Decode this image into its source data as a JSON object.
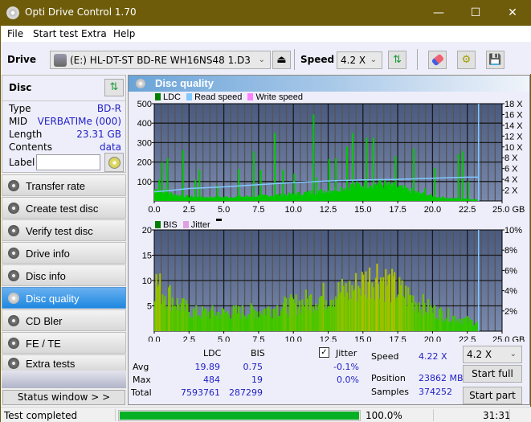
{
  "window": {
    "title": "Opti Drive Control 1.70",
    "controls": {
      "minimize": "—",
      "maximize": "☐",
      "close": "✕"
    }
  },
  "menu": [
    "File",
    "Start test",
    "Extra",
    "Help"
  ],
  "toolbar": {
    "drive_label": "Drive",
    "drive_value": "(E:)  HL-DT-ST BD-RE  WH16NS48 1.D3",
    "speed_label": "Speed",
    "speed_value": "4.2 X",
    "icons": [
      "eject-icon",
      "refresh-icon",
      "eraser-icon",
      "settings-icon",
      "save-icon"
    ]
  },
  "disc": {
    "header": "Disc",
    "rows": [
      {
        "key": "Type",
        "value": "BD-R"
      },
      {
        "key": "MID",
        "value": "VERBATIMe (000)"
      },
      {
        "key": "Length",
        "value": "23.31 GB"
      },
      {
        "key": "Contents",
        "value": "data"
      }
    ],
    "label_key": "Label",
    "label_value": ""
  },
  "nav": [
    {
      "label": "Transfer rate",
      "active": false
    },
    {
      "label": "Create test disc",
      "active": false
    },
    {
      "label": "Verify test disc",
      "active": false
    },
    {
      "label": "Drive info",
      "active": false
    },
    {
      "label": "Disc info",
      "active": false
    },
    {
      "label": "Disc quality",
      "active": true
    },
    {
      "label": "CD Bler",
      "active": false
    },
    {
      "label": "FE / TE",
      "active": false
    },
    {
      "label": "Extra tests",
      "active": false
    }
  ],
  "status_window_button": "Status window > >",
  "panel": {
    "title": "Disc quality"
  },
  "colors": {
    "ldc": "#00c800",
    "read_speed": "#80c8ff",
    "write_speed": "#ff80ff",
    "bis": "#008000",
    "jitter": "#e0a0e0",
    "plot_bg_top": "#4a5a7e",
    "plot_bg_bottom": "#7a8aae",
    "accent": "#1e88e0",
    "progress": "#06b025"
  },
  "chart_data": [
    {
      "type": "bar",
      "title": "LDC / Read speed",
      "legend": [
        "LDC",
        "Read speed",
        "Write speed"
      ],
      "legend_position": "top-left",
      "xlabel": "GB",
      "x_ticks": [
        "0.0",
        "2.5",
        "5.0",
        "7.5",
        "10.0",
        "12.5",
        "15.0",
        "17.5",
        "20.0",
        "22.5",
        "25.0 GB"
      ],
      "xlim": [
        0,
        25
      ],
      "y_left_ticks": [
        "500",
        "400",
        "300",
        "200",
        "100"
      ],
      "ylim_left": [
        0,
        500
      ],
      "y_right_ticks": [
        "18 X",
        "16 X",
        "14 X",
        "12 X",
        "10 X",
        "8 X",
        "6 X",
        "4 X",
        "2 X"
      ],
      "ylim_right": [
        0,
        18
      ],
      "grid": true,
      "end_marker_gb": 23.31,
      "ldc_baseline": [
        [
          0.0,
          60
        ],
        [
          0.5,
          55
        ],
        [
          1.0,
          40
        ],
        [
          2.0,
          25
        ],
        [
          3.0,
          20
        ],
        [
          5.0,
          20
        ],
        [
          7.5,
          25
        ],
        [
          10.0,
          35
        ],
        [
          12.5,
          55
        ],
        [
          14.0,
          75
        ],
        [
          15.5,
          90
        ],
        [
          16.5,
          85
        ],
        [
          17.5,
          70
        ],
        [
          19.0,
          40
        ],
        [
          20.0,
          25
        ],
        [
          21.0,
          15
        ],
        [
          22.5,
          10
        ],
        [
          23.3,
          8
        ]
      ],
      "ldc_spikes": [
        [
          0.3,
          110
        ],
        [
          0.5,
          200
        ],
        [
          0.9,
          220
        ],
        [
          2.0,
          260
        ],
        [
          2.9,
          110
        ],
        [
          3.2,
          160
        ],
        [
          4.5,
          80
        ],
        [
          6.0,
          165
        ],
        [
          7.1,
          255
        ],
        [
          7.6,
          160
        ],
        [
          8.6,
          350
        ],
        [
          9.2,
          160
        ],
        [
          10.0,
          140
        ],
        [
          11.4,
          445
        ],
        [
          11.6,
          120
        ],
        [
          12.5,
          215
        ],
        [
          13.0,
          220
        ],
        [
          13.8,
          280
        ],
        [
          14.2,
          350
        ],
        [
          15.2,
          325
        ],
        [
          15.7,
          325
        ],
        [
          16.2,
          115
        ],
        [
          17.3,
          230
        ],
        [
          18.6,
          270
        ],
        [
          19.4,
          65
        ],
        [
          20.1,
          170
        ],
        [
          21.8,
          240
        ],
        [
          22.1,
          255
        ],
        [
          22.5,
          100
        ]
      ],
      "read_speed": [
        [
          0.0,
          1.7
        ],
        [
          1.0,
          1.9
        ],
        [
          2.5,
          2.3
        ],
        [
          5.0,
          2.6
        ],
        [
          7.5,
          3.0
        ],
        [
          10.0,
          3.4
        ],
        [
          12.5,
          3.7
        ],
        [
          15.0,
          3.9
        ],
        [
          17.5,
          4.0
        ],
        [
          20.0,
          4.2
        ],
        [
          22.5,
          4.4
        ],
        [
          23.3,
          4.4
        ]
      ]
    },
    {
      "type": "bar",
      "title": "BIS / Jitter",
      "legend": [
        "BIS",
        "Jitter"
      ],
      "legend_position": "top-left",
      "xlabel": "GB",
      "x_ticks": [
        "0.0",
        "2.5",
        "5.0",
        "7.5",
        "10.0",
        "12.5",
        "15.0",
        "17.5",
        "20.0",
        "22.5",
        "25.0 GB"
      ],
      "xlim": [
        0,
        25
      ],
      "y_left_ticks": [
        "20",
        "15",
        "10",
        "5"
      ],
      "ylim_left": [
        0,
        20
      ],
      "y_right_ticks": [
        "10%",
        "8%",
        "6%",
        "4%",
        "2%"
      ],
      "ylim_right": [
        0,
        10
      ],
      "grid": true,
      "end_marker_gb": 23.31,
      "bis_envelope": [
        [
          0.0,
          12
        ],
        [
          0.5,
          10
        ],
        [
          1.0,
          9
        ],
        [
          1.5,
          7
        ],
        [
          2.0,
          6
        ],
        [
          2.5,
          5
        ],
        [
          3.0,
          4.5
        ],
        [
          5.0,
          4.5
        ],
        [
          7.5,
          5
        ],
        [
          10.0,
          6.5
        ],
        [
          12.5,
          9
        ],
        [
          14.0,
          10
        ],
        [
          15.0,
          12
        ],
        [
          16.0,
          14
        ],
        [
          17.0,
          11
        ],
        [
          18.0,
          9
        ],
        [
          19.0,
          7
        ],
        [
          20.0,
          5
        ],
        [
          21.0,
          4
        ],
        [
          22.0,
          3
        ],
        [
          23.3,
          2
        ]
      ]
    }
  ],
  "stats": {
    "col_ldc": "LDC",
    "col_bis": "BIS",
    "rows": [
      {
        "label": "Avg",
        "ldc": "19.89",
        "bis": "0.75"
      },
      {
        "label": "Max",
        "ldc": "484",
        "bis": "19"
      },
      {
        "label": "Total",
        "ldc": "7593761",
        "bis": "287299"
      }
    ],
    "jitter_checked": true,
    "jitter_label": "Jitter",
    "jitter_avg": "-0.1%",
    "jitter_max": "0.0%",
    "speed_label": "Speed",
    "speed_value": "4.22 X",
    "position_label": "Position",
    "position_value": "23862 MB",
    "samples_label": "Samples",
    "samples_value": "374252",
    "speed_select": "4.2 X",
    "start_full": "Start full",
    "start_part": "Start part"
  },
  "statusbar": {
    "message": "Test completed",
    "progress_percent": 100,
    "progress_text": "100.0%",
    "time": "31:31"
  }
}
